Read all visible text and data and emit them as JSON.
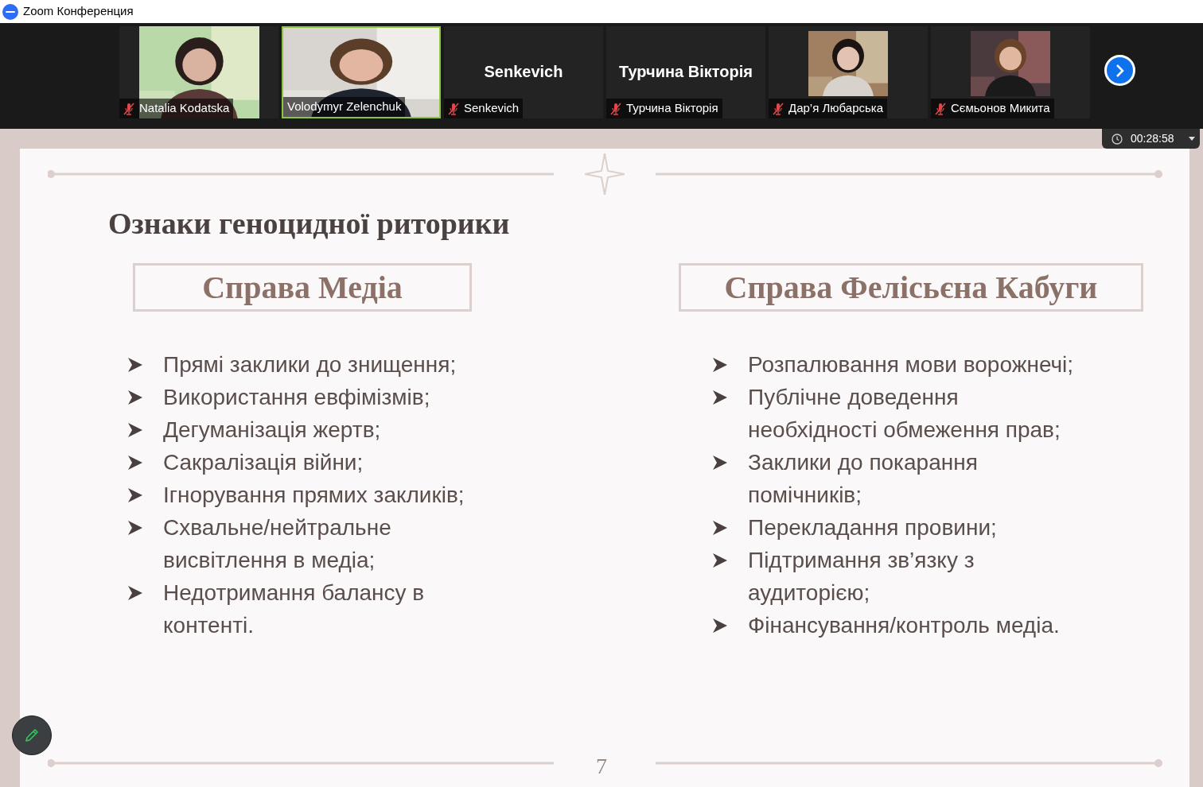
{
  "window": {
    "title": "Zoom Конференция"
  },
  "participants": [
    {
      "kind": "portrait",
      "name": "Natalia Kodatska",
      "muted": true,
      "speaking": false
    },
    {
      "kind": "video",
      "name": "Volodymyr Zelenchuk",
      "muted": false,
      "speaking": true
    },
    {
      "kind": "name",
      "title": "Senkevich",
      "name": "Senkevich",
      "muted": true,
      "speaking": false
    },
    {
      "kind": "name",
      "title": "Турчина Вікторія",
      "name": "Турчина Вікторія",
      "muted": true,
      "speaking": false
    },
    {
      "kind": "avatar",
      "name": "Дар’я Любарська",
      "muted": true,
      "speaking": false
    },
    {
      "kind": "avatar",
      "name": "Сємьонов Микита",
      "muted": true,
      "speaking": false
    }
  ],
  "timer": {
    "time": "00:28:58"
  },
  "slide": {
    "title": "Ознаки геноцидної риторики",
    "columns": [
      {
        "heading": "Справа Медіа",
        "items": [
          "Прямі заклики до знищення;",
          "Використання евфімізмів;",
          "Дегуманізація жертв;",
          "Сакралізація війни;",
          "Ігнорування прямих закликів;",
          "Схвальне/нейтральне\nвисвітлення в медіа;",
          "Недотримання балансу в\nконтенті."
        ]
      },
      {
        "heading": "Справа Фелісьєна Кабуги",
        "items": [
          "Розпалювання мови ворожнечі;",
          "Публічне доведення\nнеобхідності обмеження прав;",
          "Заклики до покарання\nпомічників;",
          "Перекладання провини;",
          "Підтримання зв’язку з\nаудиторією;",
          "Фінансування/контроль медіа."
        ]
      }
    ],
    "page_number": "7"
  }
}
